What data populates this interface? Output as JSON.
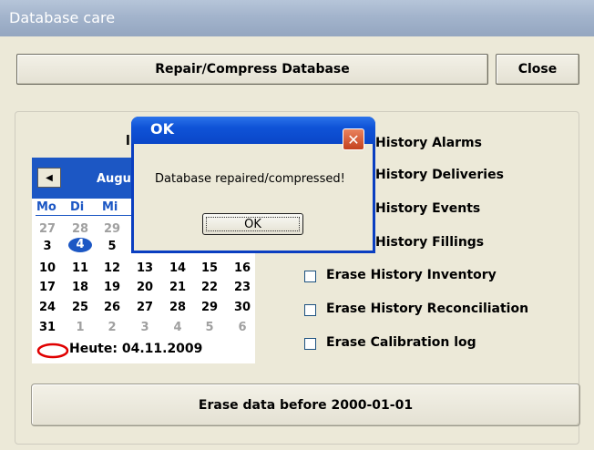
{
  "window": {
    "title": "Database care"
  },
  "toolbar": {
    "repair_label": "Repair/Compress Database",
    "close_label": "Close"
  },
  "group": {
    "label": "l"
  },
  "calendar": {
    "month_label": "Augu",
    "day_headers": [
      "Mo",
      "Di",
      "Mi"
    ],
    "week1": [
      "27",
      "28",
      "29"
    ],
    "week2": [
      "3",
      "4",
      "5"
    ],
    "week3": [
      "10",
      "11",
      "12",
      "13",
      "14",
      "15",
      "16"
    ],
    "week4": [
      "17",
      "18",
      "19",
      "20",
      "21",
      "22",
      "23"
    ],
    "week5": [
      "24",
      "25",
      "26",
      "27",
      "28",
      "29",
      "30"
    ],
    "week6": [
      "31",
      "1",
      "2",
      "3",
      "4",
      "5",
      "6"
    ],
    "today_label": "Heute: 04.11.2009"
  },
  "options": {
    "alarms": "History Alarms",
    "deliveries": "History Deliveries",
    "events": "History Events",
    "fillings": "History Fillings",
    "inventory": "Erase History Inventory",
    "reconciliation": "Erase History Reconciliation",
    "calibration": "Erase Calibration log"
  },
  "erase_button": {
    "label": "Erase data before 2000-01-01"
  },
  "dialog": {
    "title": "OK",
    "message": "Database repaired/compressed!",
    "ok_label": "OK",
    "close_glyph": "✕"
  },
  "colors": {
    "window_bg": "#ece9d8",
    "calendar_blue": "#1c57c4",
    "dialog_title_blue": "#0a46c8",
    "close_red": "#c4411e",
    "today_marker": "#e00000"
  }
}
